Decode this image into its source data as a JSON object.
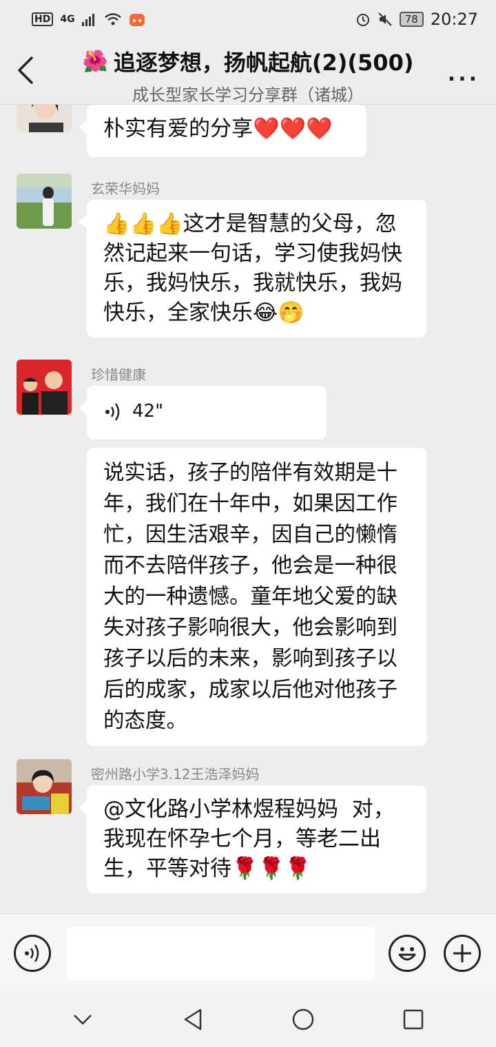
{
  "status_bar": {
    "network_badge": "HD",
    "network_type": "4G",
    "battery": "78",
    "time": "20:27"
  },
  "header": {
    "title_emoji": "🌺",
    "title": "追逐梦想，扬帆起航(2)(500)",
    "subtitle": "成长型家长学习分享群（诸城）",
    "more": "..."
  },
  "messages": [
    {
      "sender": "",
      "text": "朴实有爱的分享❤️❤️❤️"
    },
    {
      "sender": "玄荣华妈妈",
      "text": "👍👍👍这才是智慧的父母，忽然记起来一句话，学习使我妈快乐，我妈快乐，我就快乐，我妈快乐，全家快乐😂🤭"
    },
    {
      "sender": "珍惜健康",
      "voice_duration": "42\"",
      "text": "说实话，孩子的陪伴有效期是十年，我们在十年中，如果因工作忙，因生活艰辛，因自己的懒惰而不去陪伴孩子，他会是一种很大的一种遗憾。童年地父爱的缺失对孩子影响很大，他会影响到孩子以后的未来，影响到孩子以后的成家，成家以后他对他孩子的态度。"
    },
    {
      "sender": "密州路小学3.12王浩泽妈妈",
      "text": "@文化路小学林煜程妈妈  对，我现在怀孕七个月，等老二出生，平等对待🌹🌹🌹"
    }
  ],
  "input": {
    "placeholder": ""
  },
  "icons": {
    "back": "back-arrow-icon",
    "more": "more-dots-icon",
    "voice": "voice-icon",
    "emoji": "emoji-icon",
    "add": "add-icon"
  }
}
